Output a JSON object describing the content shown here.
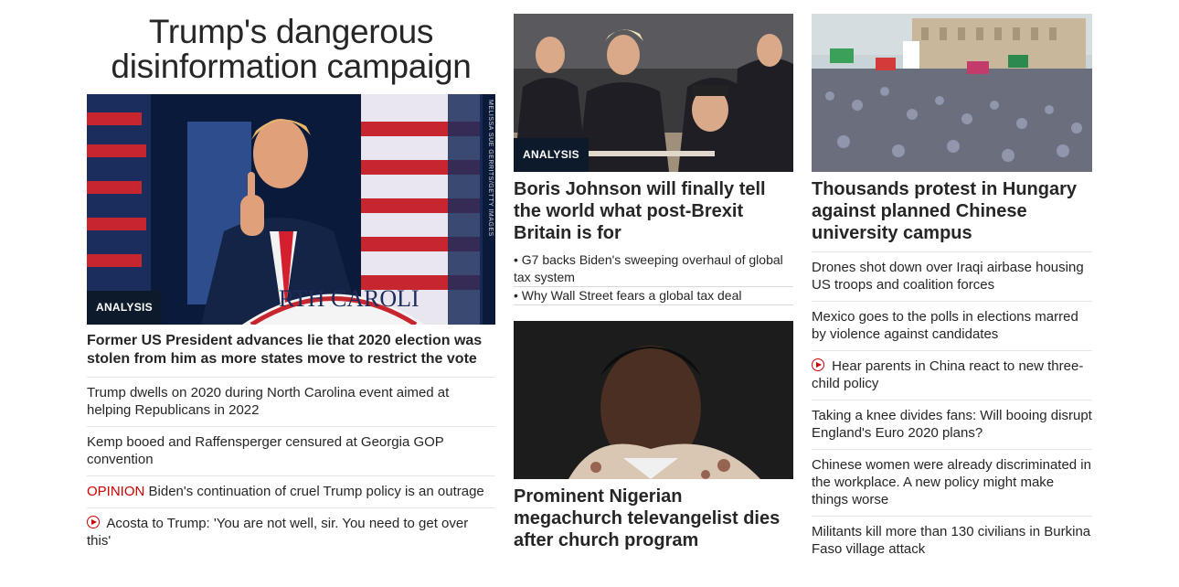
{
  "column1": {
    "hero_title": "Trump's dangerous disinformation campaign",
    "image_badge": "ANALYSIS",
    "image_credit": "MELISSA SUE GERRITS/GETTY IMAGES",
    "headline": "Former US President advances lie that 2020 election was stolen from him as more states move to restrict the vote",
    "items": [
      {
        "text": "Trump dwells on 2020 during North Carolina event aimed at helping Republicans in 2022"
      },
      {
        "text": "Kemp booed and Raffensperger censured at Georgia GOP convention"
      },
      {
        "prefix": "OPINION",
        "text": "Biden's continuation of cruel Trump policy is an outrage"
      },
      {
        "icon": "play-icon",
        "text": "Acosta to Trump: 'You are not well, sir. You need to get over this'"
      }
    ]
  },
  "column2": {
    "story1": {
      "image_badge": "ANALYSIS",
      "headline": "Boris Johnson will finally tell the world what post-Brexit Britain is for",
      "links": [
        "• G7 backs Biden's sweeping overhaul of global tax system",
        "• Why Wall Street fears a global tax deal"
      ]
    },
    "story2": {
      "headline": "Prominent Nigerian megachurch televangelist dies after church program"
    }
  },
  "column3": {
    "headline": "Thousands protest in Hungary against planned Chinese university campus",
    "items": [
      {
        "text": "Drones shot down over Iraqi airbase housing US troops and coalition forces"
      },
      {
        "text": "Mexico goes to the polls in elections marred by violence against candidates"
      },
      {
        "icon": "play-icon",
        "text": "Hear parents in China react to new three-child policy"
      },
      {
        "text": "Taking a knee divides fans: Will booing disrupt England's Euro 2020 plans?"
      },
      {
        "text": "Chinese women were already discriminated in the workplace. A new policy might make things worse"
      },
      {
        "text": "Militants kill more than 130 civilians in Burkina Faso village attack"
      }
    ]
  },
  "colors": {
    "badge_bg": "#0c1a2b",
    "opinion_red": "#cc0000",
    "text": "#262626",
    "divider": "#e6e6e6"
  }
}
